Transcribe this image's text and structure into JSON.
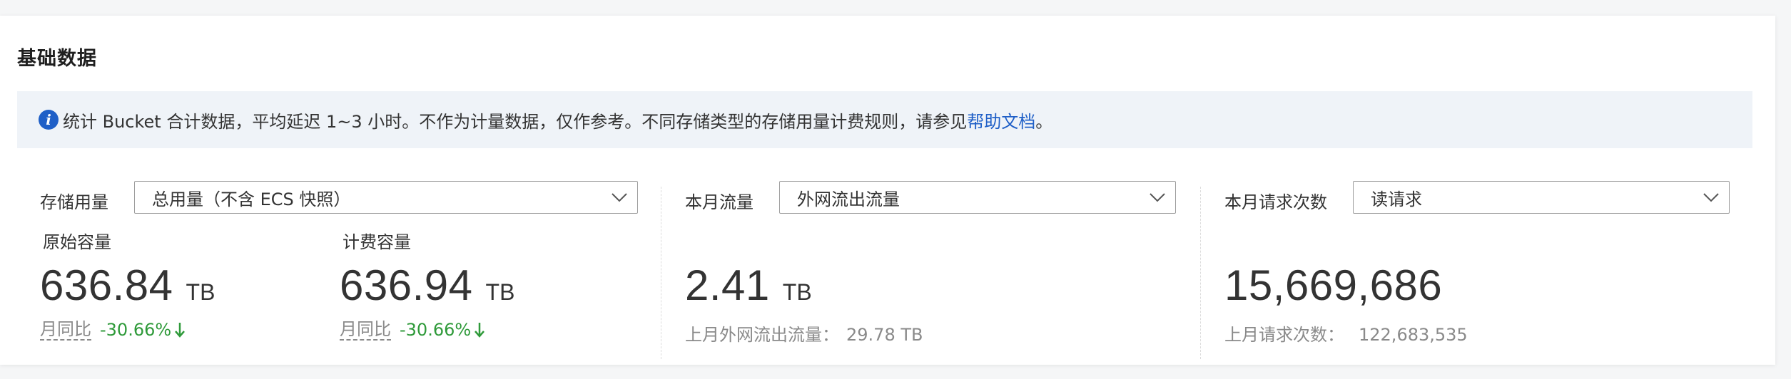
{
  "card_title": "基础数据",
  "notice": {
    "text": "统计 Bucket 合计数据，平均延迟 1~3 小时。不作为计量数据，仅作参考。不同存储类型的存储用量计费规则，请参见",
    "link_text": "帮助文档",
    "suffix": "。"
  },
  "storage": {
    "label": "存储用量",
    "select_value": "总用量（不含 ECS 快照）",
    "raw": {
      "label": "原始容量",
      "value": "636.84",
      "unit": "TB",
      "yoy_label": "月同比",
      "yoy_value": "-30.66%"
    },
    "billed": {
      "label": "计费容量",
      "value": "636.94",
      "unit": "TB",
      "yoy_label": "月同比",
      "yoy_value": "-30.66%"
    }
  },
  "traffic": {
    "label": "本月流量",
    "select_value": "外网流出流量",
    "value": "2.41",
    "unit": "TB",
    "prev_label": "上月外网流出流量：",
    "prev_value": "29.78 TB"
  },
  "requests": {
    "label": "本月请求次数",
    "select_value": "读请求",
    "value": "15,669,686",
    "prev_label": "上月请求次数：",
    "prev_value": "122,683,535"
  },
  "colors": {
    "accent": "#1f5fc7",
    "positive_change": "#2f9a3a",
    "notice_bg": "#eff3f8"
  }
}
